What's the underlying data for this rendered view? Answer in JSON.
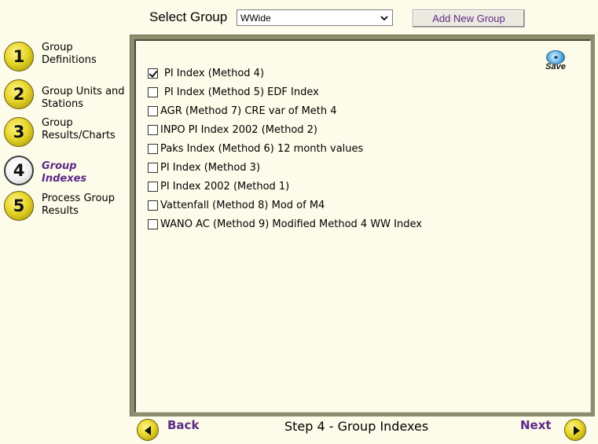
{
  "top": {
    "select_label": "Select Group",
    "group_select": {
      "value": "WWide"
    },
    "add_button": "Add New Group"
  },
  "nav": {
    "items": [
      {
        "num": "1",
        "label_lines": [
          "Group",
          "Definitions"
        ],
        "active": false
      },
      {
        "num": "2",
        "label_lines": [
          "Group Units and",
          "Stations"
        ],
        "active": false
      },
      {
        "num": "3",
        "label_lines": [
          "Group",
          "Results/Charts"
        ],
        "active": false
      },
      {
        "num": "4",
        "label_lines": [
          "Group",
          "Indexes"
        ],
        "active": true
      },
      {
        "num": "5",
        "label_lines": [
          "Process Group",
          "Results"
        ],
        "active": false
      }
    ]
  },
  "panel": {
    "save_label": "Save",
    "indexes": [
      {
        "label": "PI Index (Method 4)",
        "checked": true
      },
      {
        "label": "PI Index (Method 5) EDF Index",
        "checked": false
      },
      {
        "label": "AGR (Method 7) CRE var of Meth 4",
        "checked": false
      },
      {
        "label": "INPO PI Index 2002 (Method 2)",
        "checked": false
      },
      {
        "label": "Paks Index (Method 6) 12 month values",
        "checked": false
      },
      {
        "label": "PI Index (Method 3)",
        "checked": false
      },
      {
        "label": "PI Index 2002 (Method 1)",
        "checked": false
      },
      {
        "label": "Vattenfall (Method 8) Mod of M4",
        "checked": false
      },
      {
        "label": "WANO AC (Method 9) Modified Method 4 WW Index",
        "checked": false
      }
    ]
  },
  "footer": {
    "back_label": "Back",
    "step_title": "Step 4 - Group Indexes",
    "next_label": "Next"
  },
  "colors": {
    "accent_purple": "#5b2a86",
    "panel_frame": "#8e8e6e",
    "background": "#fdfbe9",
    "step_yellow": "#e7d72a"
  }
}
